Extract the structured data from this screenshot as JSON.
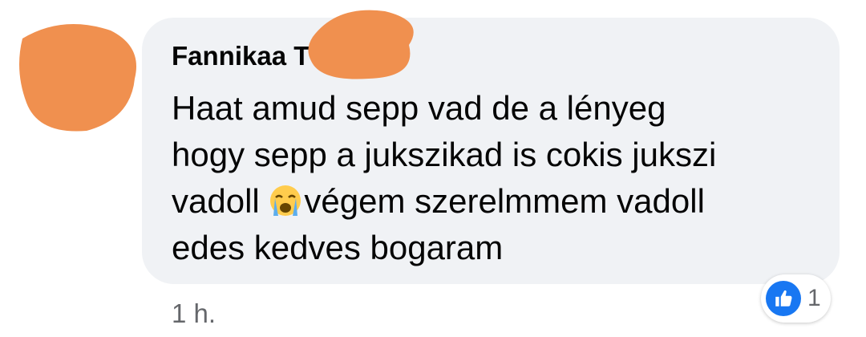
{
  "comment": {
    "author": "Fannikaa T",
    "lines": [
      "Haat amud sepp vad de a lényeg",
      "hogy sepp a jukszikad is cokis jukszi",
      "vadoll",
      "végem szerelmmem vadoll",
      "edes kedves bogaram"
    ],
    "emoji": "loudly-crying-face-icon",
    "timestamp": "1 h."
  },
  "reactions": {
    "icon": "like-icon",
    "count": "1"
  },
  "colors": {
    "bubble": "#f0f2f5",
    "like_blue": "#1877f2",
    "secondary_text": "#65676b",
    "redaction_orange": "#f0904f"
  }
}
